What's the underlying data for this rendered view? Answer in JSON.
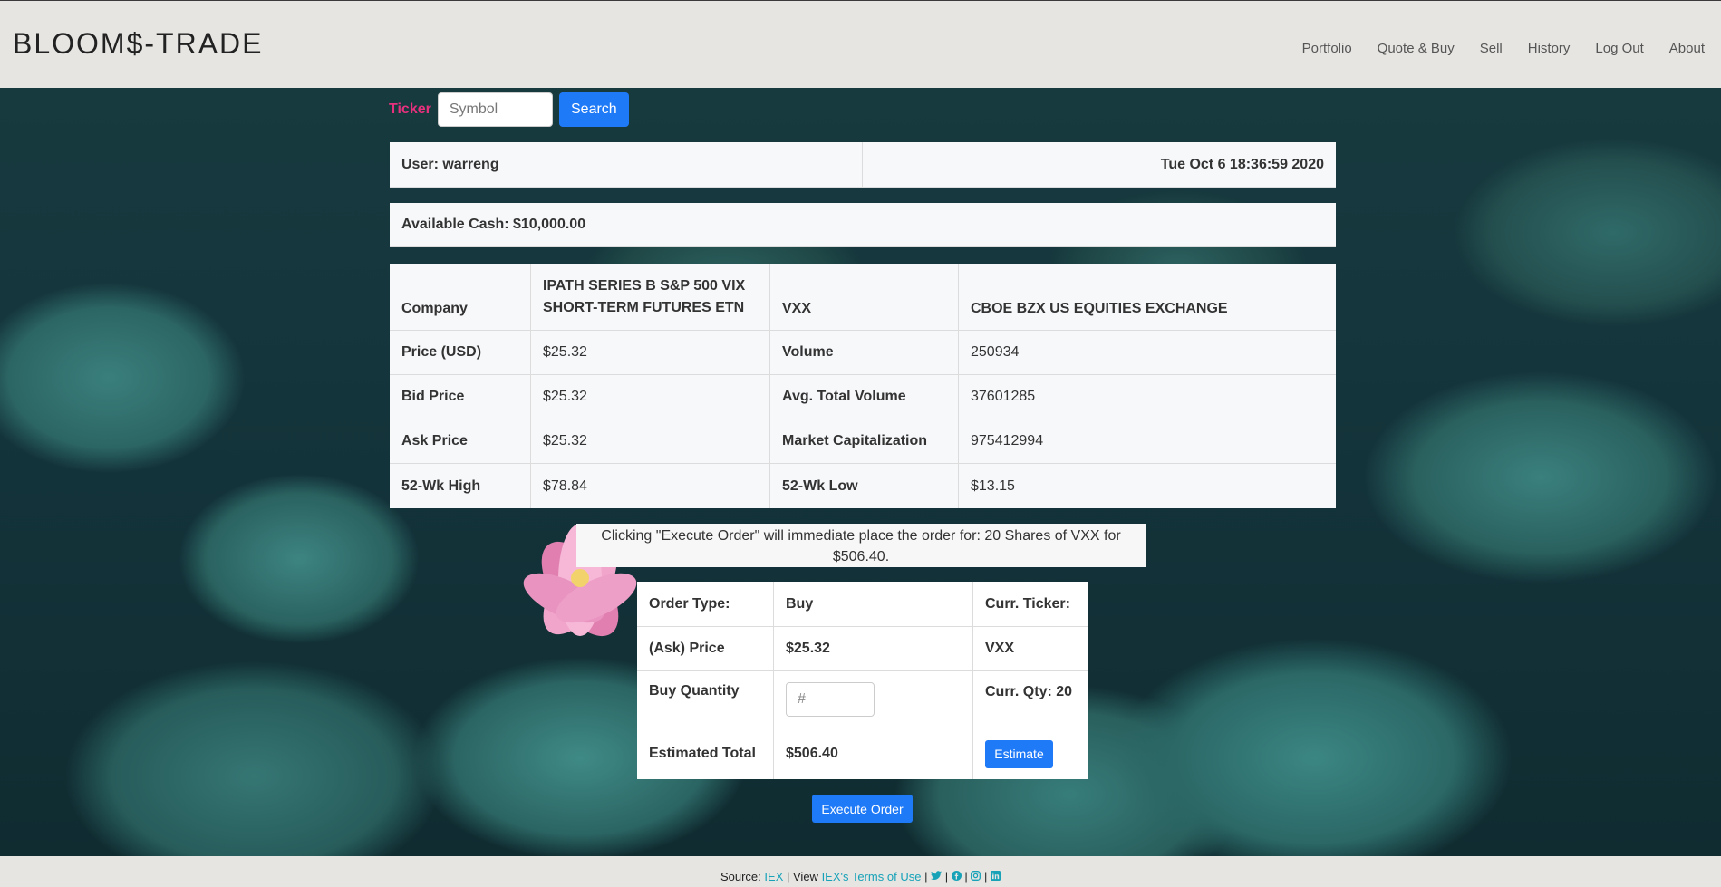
{
  "brand": "BLOOM$-TRADE",
  "nav": [
    "Portfolio",
    "Quote & Buy",
    "Sell",
    "History",
    "Log Out",
    "About"
  ],
  "ticker": {
    "label": "Ticker",
    "placeholder": "Symbol",
    "search_label": "Search"
  },
  "header": {
    "user": "User: warreng",
    "datetime": "Tue Oct 6 18:36:59 2020",
    "cash": "Available Cash: $10,000.00"
  },
  "quote": {
    "company_label": "Company",
    "company_name": "IPATH SERIES B S&P 500 VIX SHORT-TERM FUTURES ETN",
    "symbol": "VXX",
    "exchange": "CBOE BZX US EQUITIES EXCHANGE",
    "rows": [
      {
        "l1": "Price (USD)",
        "v1": "$25.32",
        "l2": "Volume",
        "v2": "250934"
      },
      {
        "l1": "Bid Price",
        "v1": "$25.32",
        "l2": "Avg. Total Volume",
        "v2": "37601285"
      },
      {
        "l1": "Ask Price",
        "v1": "$25.32",
        "l2": "Market Capitalization",
        "v2": "975412994"
      },
      {
        "l1": "52-Wk High",
        "v1": "$78.84",
        "l2": "52-Wk Low",
        "v2": "$13.15"
      }
    ]
  },
  "notice": "Clicking \"Execute Order\" will immediate place the order for: 20 Shares of VXX for $506.40.",
  "order": {
    "type_label": "Order Type:",
    "type_value": "Buy",
    "curr_ticker_label": "Curr. Ticker:",
    "price_label": "(Ask) Price",
    "price_value": "$25.32",
    "ticker_value": "VXX",
    "qty_label": "Buy Quantity",
    "qty_placeholder": "#",
    "curr_qty": "Curr. Qty: 20",
    "total_label": "Estimated Total",
    "total_value": "$506.40",
    "estimate_label": "Estimate"
  },
  "execute_label": "Execute Order",
  "footer": {
    "source_prefix": "Source:",
    "source_link": "IEX",
    "view_prefix": "| View",
    "terms_link": "IEX's Terms of Use",
    "sep": "|"
  },
  "colors": {
    "accent": "#1f7af7",
    "ticker_label": "#e8317d",
    "link": "#17a2b8",
    "navbar": "#e6e5e2"
  }
}
